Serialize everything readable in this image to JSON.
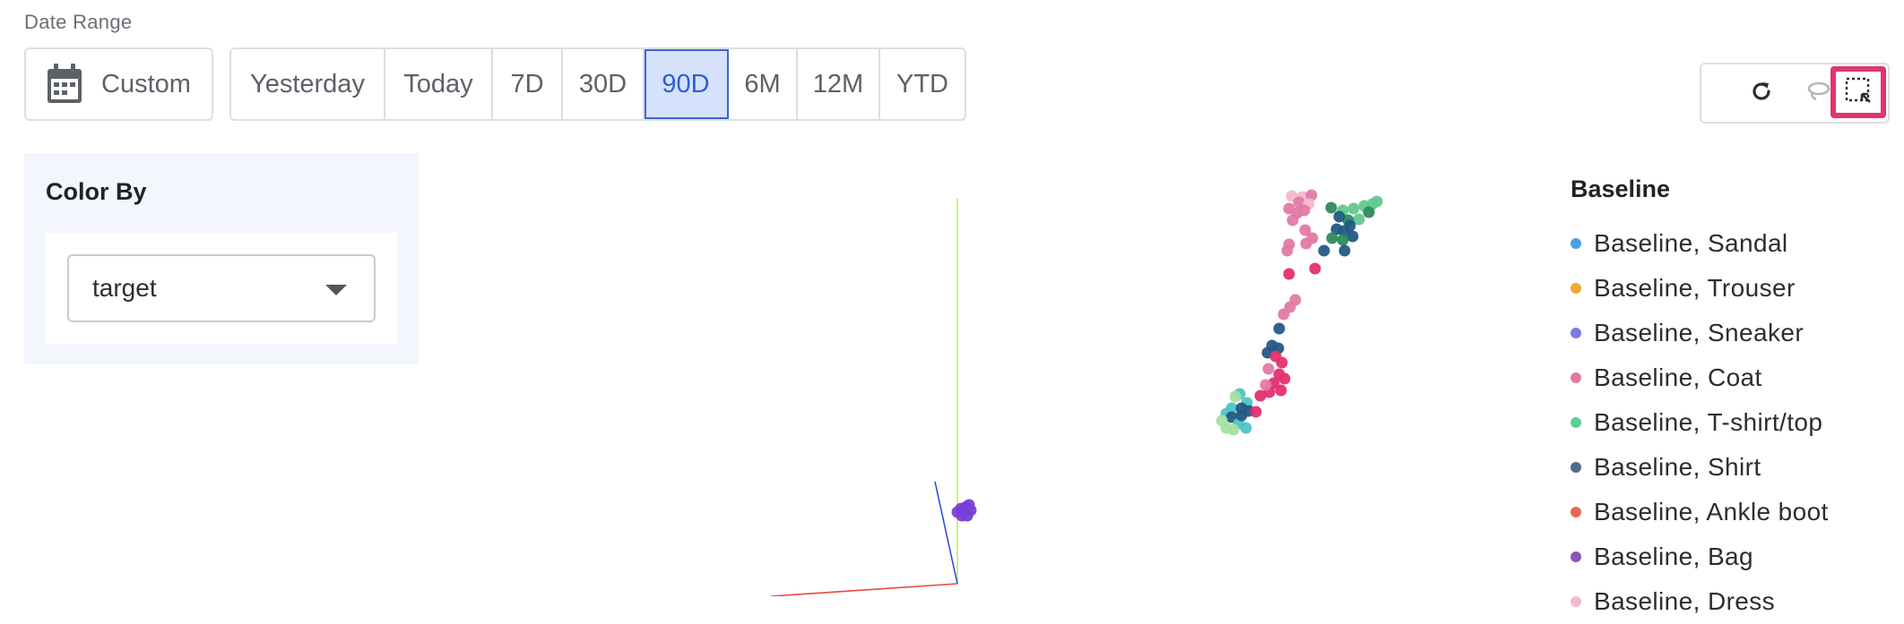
{
  "date_range": {
    "label": "Date Range",
    "custom_label": "Custom",
    "options": [
      "Yesterday",
      "Today",
      "7D",
      "30D",
      "90D",
      "6M",
      "12M",
      "YTD"
    ],
    "selected": "90D"
  },
  "toolbar": {
    "tools": [
      "refresh-icon",
      "lasso-icon",
      "box-select-icon"
    ],
    "selected": "box-select-icon"
  },
  "color_by": {
    "title": "Color By",
    "value": "target"
  },
  "legend": {
    "title": "Baseline",
    "items": [
      {
        "label": "Baseline, Sandal",
        "color": "#4a9ee6"
      },
      {
        "label": "Baseline, Trouser",
        "color": "#f0a93a"
      },
      {
        "label": "Baseline, Sneaker",
        "color": "#7b7be6"
      },
      {
        "label": "Baseline, Coat",
        "color": "#e07a9e"
      },
      {
        "label": "Baseline, T-shirt/top",
        "color": "#5fcf93"
      },
      {
        "label": "Baseline, Shirt",
        "color": "#4d6c8c"
      },
      {
        "label": "Baseline, Ankle boot",
        "color": "#e46a4e"
      },
      {
        "label": "Baseline, Bag",
        "color": "#8e52b8"
      },
      {
        "label": "Baseline, Dress",
        "color": "#f4b9cc"
      }
    ]
  },
  "point_colors": {
    "coat": "#e07aa5",
    "tshirt": "#62c98d",
    "tshirt_dark": "#2e8a5e",
    "shirt": "#235a86",
    "pink": "#e2306e",
    "dress": "#f3b8c9",
    "teal": "#4ec4c9",
    "lightgreen": "#a7e0a0",
    "bag": "#7a3fd6",
    "axis_y": "#b9ef6a",
    "axis_x": "#e84a3c",
    "axis_z": "#2f4fe0"
  }
}
